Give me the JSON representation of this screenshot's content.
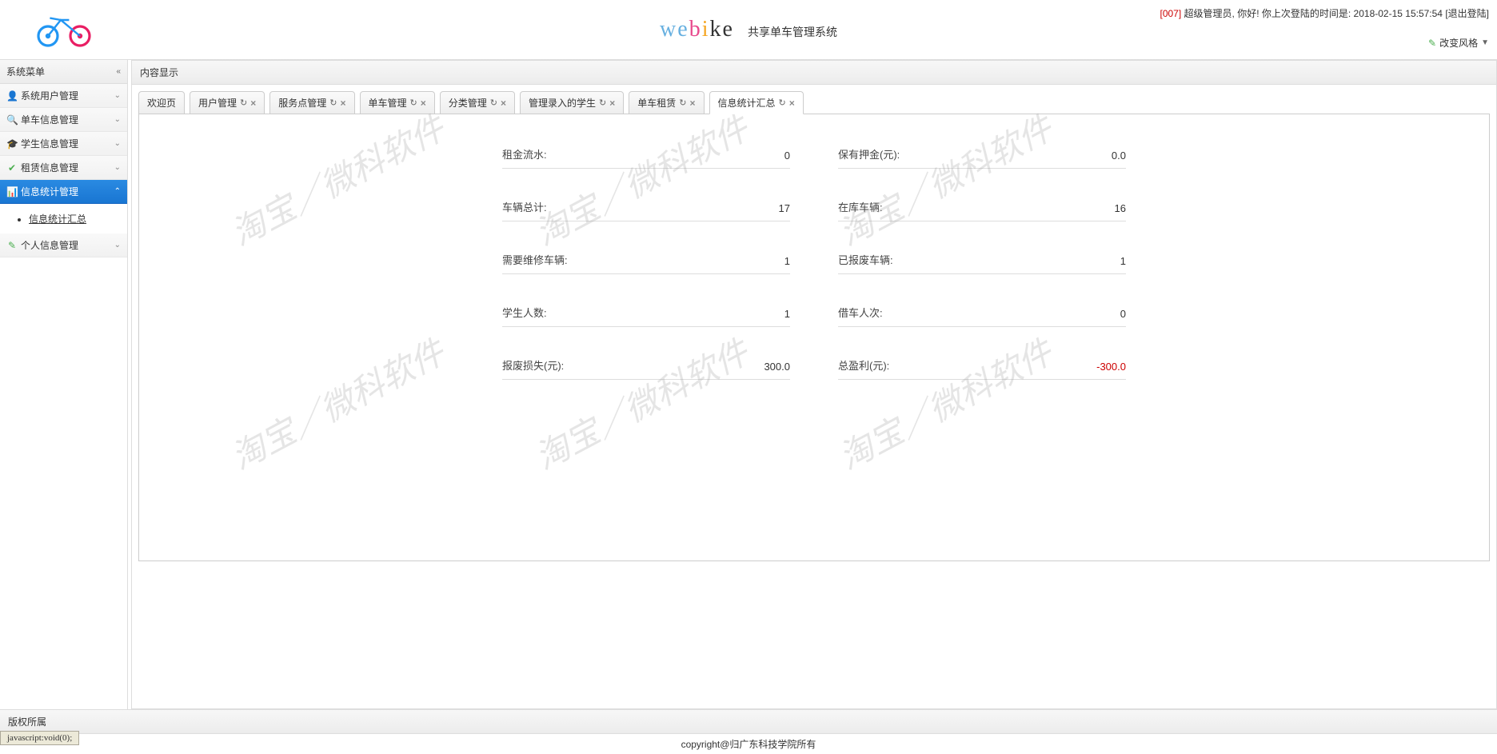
{
  "header": {
    "brand_sub": "共享单车管理系统",
    "user_id": "[007]",
    "greeting": "超级管理员, 你好! 你上次登陆的时间是: 2018-02-15 15:57:54",
    "logout": "[退出登陆]",
    "theme_switch": "改变风格"
  },
  "sidebar": {
    "title": "系统菜单",
    "items": [
      {
        "icon": "👤",
        "label": "系统用户管理",
        "expand": "v"
      },
      {
        "icon": "🔍",
        "label": "单车信息管理",
        "expand": "v"
      },
      {
        "icon": "🎓",
        "label": "学生信息管理",
        "expand": "v"
      },
      {
        "icon": "✔",
        "label": "租赁信息管理",
        "expand": "v"
      },
      {
        "icon": "📊",
        "label": "信息统计管理",
        "expand": "^",
        "active": true
      },
      {
        "icon": "✎",
        "label": "个人信息管理",
        "expand": "v"
      }
    ],
    "sub_item": "信息统计汇总"
  },
  "main": {
    "title": "内容显示",
    "tabs": [
      {
        "label": "欢迎页",
        "closable": false
      },
      {
        "label": "用户管理",
        "closable": true
      },
      {
        "label": "服务点管理",
        "closable": true
      },
      {
        "label": "单车管理",
        "closable": true
      },
      {
        "label": "分类管理",
        "closable": true
      },
      {
        "label": "管理录入的学生",
        "closable": true
      },
      {
        "label": "单车租赁",
        "closable": true
      },
      {
        "label": "信息统计汇总",
        "closable": true,
        "active": true
      }
    ]
  },
  "stats": [
    {
      "label": "租金流水:",
      "value": "0"
    },
    {
      "label": "保有押金(元):",
      "value": "0.0"
    },
    {
      "label": "车辆总计:",
      "value": "17"
    },
    {
      "label": "在库车辆:",
      "value": "16"
    },
    {
      "label": "需要维修车辆:",
      "value": "1"
    },
    {
      "label": "已报废车辆:",
      "value": "1"
    },
    {
      "label": "学生人数:",
      "value": "1"
    },
    {
      "label": "借车人次:",
      "value": "0"
    },
    {
      "label": "报废损失(元):",
      "value": "300.0"
    },
    {
      "label": "总盈利(元):",
      "value": "-300.0",
      "neg": true
    }
  ],
  "watermark": "淘宝／微科软件",
  "footer": {
    "title": "版权所属",
    "copyright": "copyright@归广东科技学院所有"
  },
  "status": "javascript:void(0);"
}
